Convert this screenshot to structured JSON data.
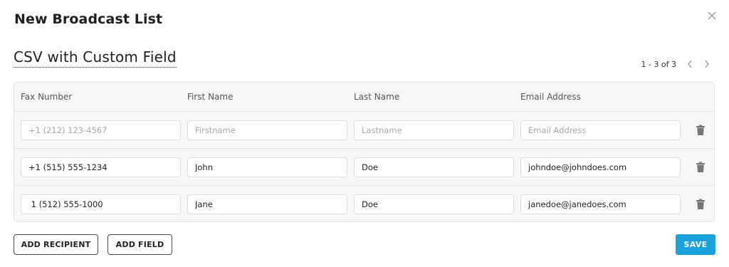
{
  "dialog": {
    "title": "New Broadcast List",
    "close_icon": "close-icon"
  },
  "list": {
    "name": "CSV with Custom Field"
  },
  "pagination": {
    "text": "1 - 3 of 3",
    "prev_icon": "chevron-left-icon",
    "next_icon": "chevron-right-icon"
  },
  "table": {
    "columns": [
      "Fax Number",
      "First Name",
      "Last Name",
      "Email Address"
    ],
    "new_row_placeholders": [
      "+1 (212) 123-4567",
      "Firstname",
      "Lastname",
      "Email Address"
    ],
    "rows": [
      [
        "+1 (515) 555-1234",
        "John",
        "Doe",
        "johndoe@johndoes.com"
      ],
      [
        " 1 (512) 555-1000",
        "Jane",
        "Doe",
        "janedoe@janedoes.com"
      ]
    ],
    "row_action_icon": "trash-icon"
  },
  "footer": {
    "add_recipient_label": "ADD RECIPIENT",
    "add_field_label": "ADD FIELD",
    "save_label": "SAVE"
  },
  "colors": {
    "accent": "#1ba1dc",
    "table_bg": "#f7f7f9",
    "border": "#e3e3e8"
  }
}
